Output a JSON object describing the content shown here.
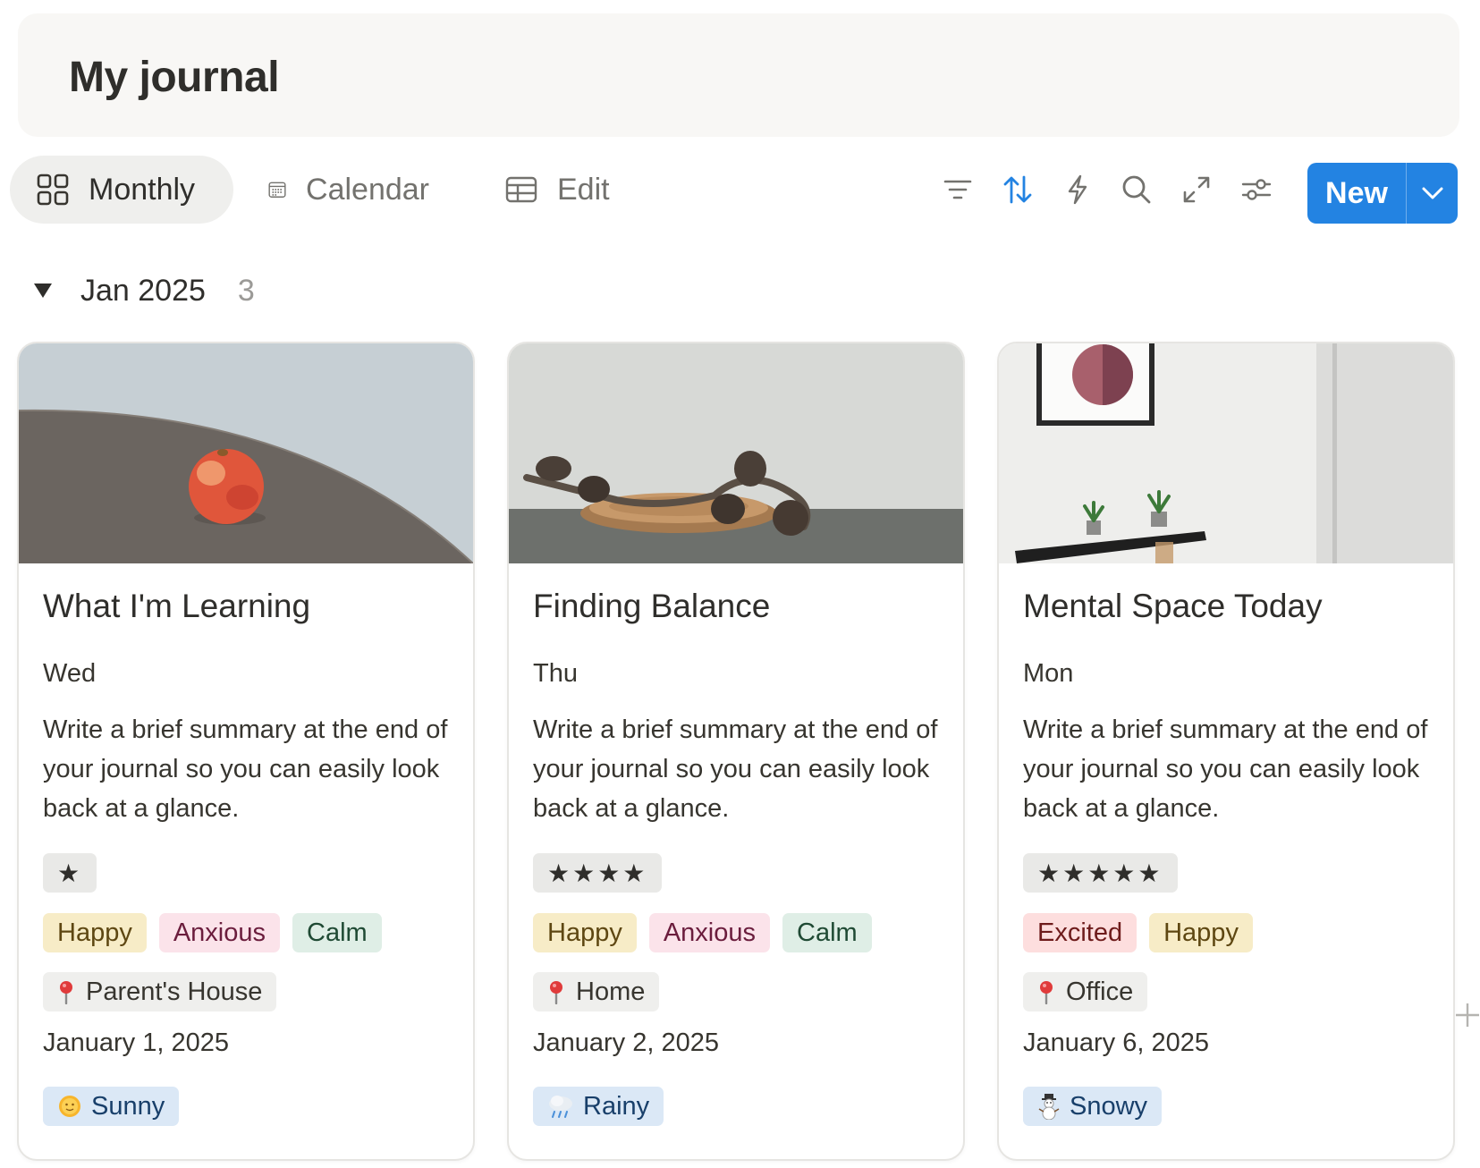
{
  "page": {
    "title": "My journal"
  },
  "views": [
    {
      "label": "Monthly",
      "icon": "gallery-icon",
      "active": true
    },
    {
      "label": "Calendar",
      "icon": "calendar-icon",
      "active": false
    },
    {
      "label": "Edit",
      "icon": "table-icon",
      "active": false
    }
  ],
  "toolbar": {
    "icons": [
      "filter-icon",
      "sort-icon",
      "automation-icon",
      "search-icon",
      "expand-icon",
      "settings-icon"
    ],
    "new_label": "New",
    "accent": "#2383e2",
    "sort_active_color": "#2383e2"
  },
  "group": {
    "name": "Jan 2025",
    "count": "3"
  },
  "cards": [
    {
      "title": "What I'm Learning",
      "day": "Wed",
      "summary": "Write a brief summary at the end of your journal so you can easily look back at a glance.",
      "rating": "★",
      "moods": [
        {
          "label": "Happy",
          "color": "yellow"
        },
        {
          "label": "Anxious",
          "color": "pink"
        },
        {
          "label": "Calm",
          "color": "green"
        }
      ],
      "location": "Parent's House",
      "date": "January 1, 2025",
      "weather": "Sunny",
      "weather_icon": "sun-icon",
      "cover": "apple-on-table"
    },
    {
      "title": "Finding Balance",
      "day": "Thu",
      "summary": "Write a brief summary at the end of your journal so you can easily look back at a glance.",
      "rating": "★★★★",
      "moods": [
        {
          "label": "Happy",
          "color": "yellow"
        },
        {
          "label": "Anxious",
          "color": "pink"
        },
        {
          "label": "Calm",
          "color": "green"
        }
      ],
      "location": "Home",
      "date": "January 2, 2025",
      "weather": "Rainy",
      "weather_icon": "rain-cloud-icon",
      "cover": "pinecones-on-plate"
    },
    {
      "title": "Mental Space Today",
      "day": "Mon",
      "summary": "Write a brief summary at the end of your journal so you can easily look back at a glance.",
      "rating": "★★★★★",
      "moods": [
        {
          "label": "Excited",
          "color": "red"
        },
        {
          "label": "Happy",
          "color": "yellow"
        }
      ],
      "location": "Office",
      "date": "January 6, 2025",
      "weather": "Snowy",
      "weather_icon": "snowman-icon",
      "cover": "shelf-with-plants"
    }
  ]
}
